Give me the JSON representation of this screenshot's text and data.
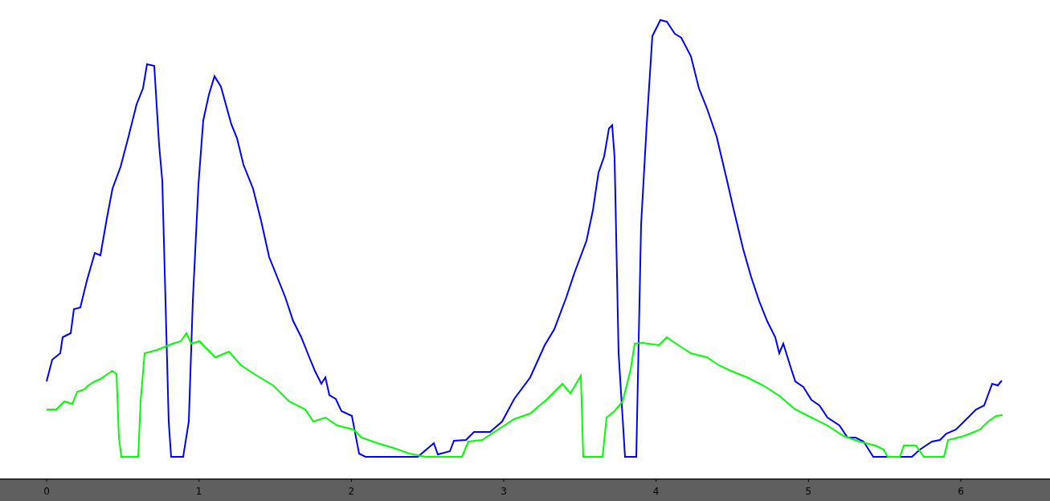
{
  "x_axis": {
    "tick_labels": [
      "0",
      "1",
      "2",
      "3",
      "4",
      "5",
      "6"
    ]
  }
}
